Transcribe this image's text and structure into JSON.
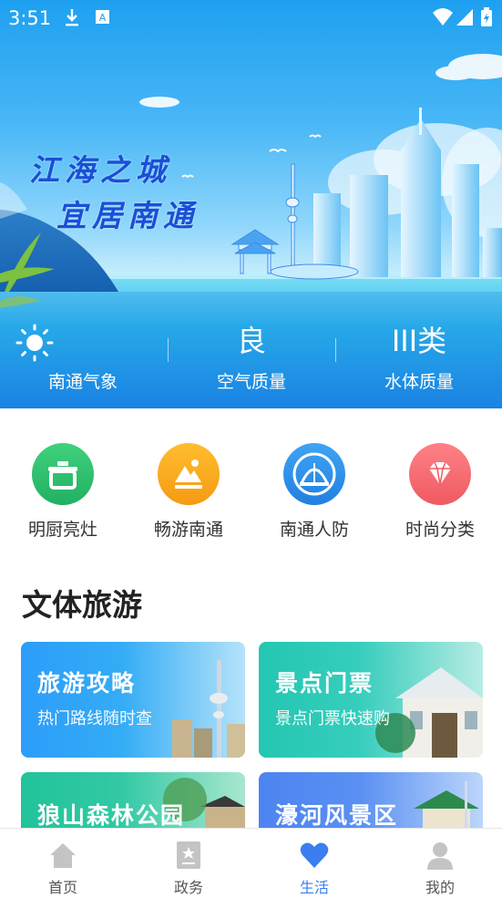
{
  "status_bar": {
    "time": "3:51",
    "left_icons": [
      "download-icon",
      "a-notification-icon"
    ],
    "right_icons": [
      "wifi-icon",
      "signal-icon",
      "battery-icon"
    ]
  },
  "banner": {
    "slogan_line1": "江海之城",
    "slogan_line2": "宜居南通"
  },
  "metrics": [
    {
      "icon": "sun-icon",
      "value": "",
      "label": "南通气象"
    },
    {
      "value": "良",
      "label": "空气质量"
    },
    {
      "value": "III类",
      "label": "水体质量"
    }
  ],
  "services": [
    {
      "icon": "pot-icon",
      "label": "明厨亮灶",
      "color": "#2dbd6e"
    },
    {
      "icon": "mountain-icon",
      "label": "畅游南通",
      "color": "#f7a51c"
    },
    {
      "icon": "shelter-icon",
      "label": "南通人防",
      "color": "#2f8fe8"
    },
    {
      "icon": "diamond-icon",
      "label": "时尚分类",
      "color": "#f26a6f"
    }
  ],
  "section": {
    "title": "文体旅游"
  },
  "cards": [
    {
      "title": "旅游攻略",
      "subtitle": "热门路线随时查"
    },
    {
      "title": "景点门票",
      "subtitle": "景点门票快速购"
    },
    {
      "title": "狼山森林公园",
      "subtitle": ""
    },
    {
      "title": "濠河风景区",
      "subtitle": ""
    }
  ],
  "tabbar": {
    "items": [
      {
        "icon": "home-icon",
        "label": "首页"
      },
      {
        "icon": "government-icon",
        "label": "政务"
      },
      {
        "icon": "heart-icon",
        "label": "生活"
      },
      {
        "icon": "user-icon",
        "label": "我的"
      }
    ],
    "active": "生活",
    "active_color": "#3a7ef0",
    "inactive_color": "#c4c4c4"
  }
}
